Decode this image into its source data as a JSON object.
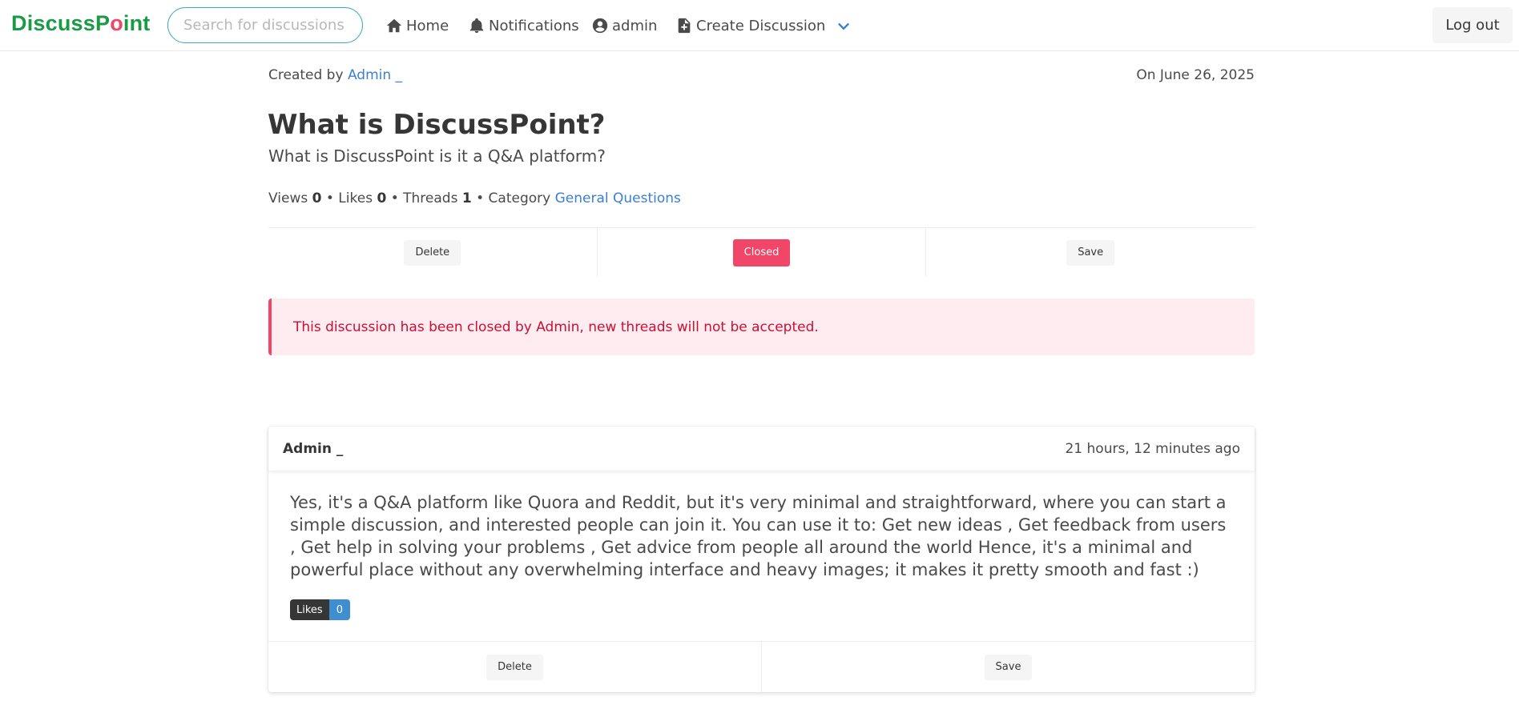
{
  "nav": {
    "brand_part1": "Discuss",
    "brand_part2": "P",
    "brand_o": "o",
    "brand_part3": "int",
    "search_placeholder": "Search for discussions",
    "home": "Home",
    "notifications": "Notifications",
    "user": "admin",
    "create": "Create Discussion",
    "logout": "Log out"
  },
  "discussion": {
    "created_by_label": "Created by",
    "author": "Admin _",
    "date": "On June 26, 2025",
    "title": "What is DiscussPoint?",
    "subtitle": "What is DiscussPoint is it a Q&A platform?",
    "views_label": "Views",
    "views": "0",
    "likes_label": "Likes",
    "likes": "0",
    "threads_label": "Threads",
    "threads": "1",
    "category_label": "Category",
    "category": "General Questions",
    "delete_label": "Delete",
    "closed_label": "Closed",
    "save_label": "Save",
    "closed_notice": "This discussion has been closed by Admin, new threads will not be accepted."
  },
  "thread": {
    "author": "Admin _",
    "time": "21 hours, 12 minutes ago",
    "body": "Yes, it's a Q&A platform like Quora and Reddit, but it's very minimal and straightforward, where you can start a simple discussion, and interested people can join it. You can use it to: Get new ideas , Get feedback from users , Get help in solving your problems , Get advice from people all around the world Hence, it's a minimal and powerful place without any overwhelming interface and heavy images; it makes it pretty smooth and fast :)",
    "likes_label": "Likes",
    "likes_count": "0",
    "delete_label": "Delete",
    "save_label": "Save"
  },
  "colors": {
    "brand": "#1b9a46",
    "brand_accent": "#f14668",
    "link": "#3b7fd4",
    "danger": "#f14668",
    "info": "#3e8ed0"
  },
  "icons": {
    "home": "home-icon",
    "notifications": "bell-icon",
    "user": "user-circle-icon",
    "create": "file-plus-icon",
    "more": "chevron-down-icon"
  }
}
